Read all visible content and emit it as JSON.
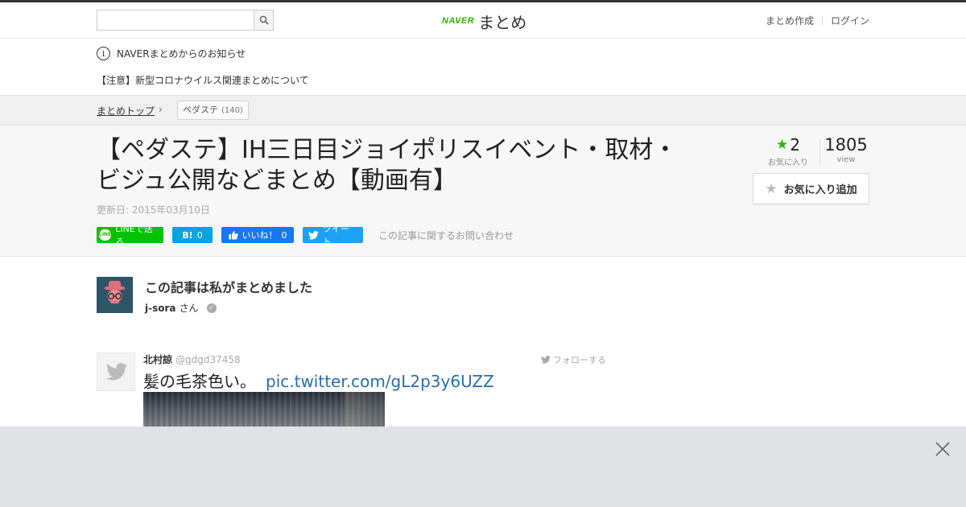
{
  "header": {
    "search": {
      "placeholder": "",
      "value": ""
    },
    "logo": {
      "brand": "NAVER",
      "service": "まとめ"
    },
    "links": {
      "create": "まとめ作成",
      "login": "ログイン"
    }
  },
  "notice": {
    "title": "NAVERまとめからのお知らせ",
    "item": "【注意】新型コロナウイルス関連まとめについて"
  },
  "breadcrumb": {
    "home": "まとめトップ",
    "chevron": "›",
    "tag": "ペダステ",
    "tag_count": "(140)"
  },
  "article": {
    "title": "【ペダステ】IH三日目ジョイポリスイベント・取材・ビジュ公開などまとめ【動画有】",
    "updated": "更新日: 2015年03月10日",
    "favorites": "2",
    "favorites_label": "お気に入り",
    "views": "1805",
    "views_label": "view",
    "fav_button": "お気に入り追加"
  },
  "share": {
    "line": "LINEで送る",
    "line_icon_text": "LINE",
    "hatena": "B!",
    "hatena_count": "0",
    "facebook": "いいね！",
    "facebook_count": "0",
    "twitter": "ツイート",
    "contact": "この記事に関するお問い合わせ"
  },
  "author": {
    "heading": "この記事は私がまとめました",
    "name": "j-sora",
    "suffix": "さん"
  },
  "tweet": {
    "name": "北村諒",
    "handle": "@gdgd37458",
    "follow": "フォローする",
    "text": "髪の毛茶色い。",
    "link": "pic.twitter.com/gL2p3y6UZZ"
  },
  "colors": {
    "naver_green": "#2db400",
    "line_green": "#00c300",
    "hatena_blue": "#00a4de",
    "facebook_blue": "#1877f2",
    "twitter_blue": "#1da1f2",
    "link_blue": "#2b6dad"
  },
  "icons": [
    "search-icon",
    "info-icon",
    "chevron-right-icon",
    "star-icon",
    "line-icon",
    "facebook-like-icon",
    "twitter-bird-icon",
    "verified-check-icon",
    "close-icon"
  ]
}
